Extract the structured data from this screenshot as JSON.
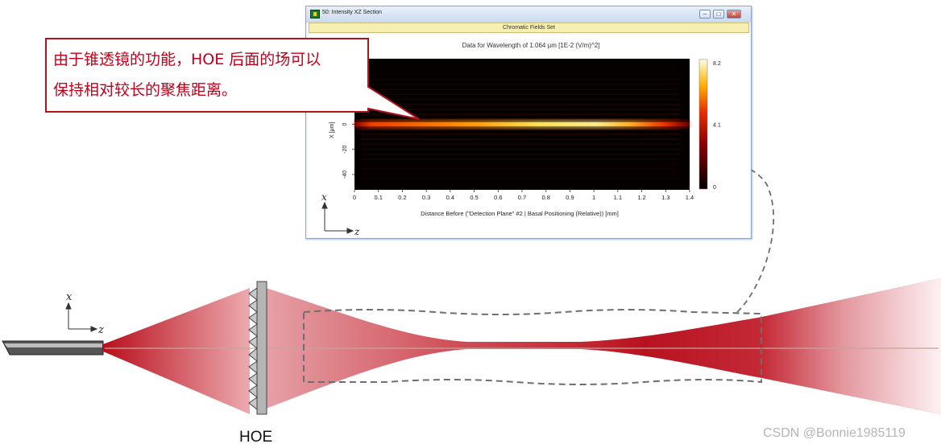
{
  "window": {
    "title": "50: Intensity XZ Section",
    "buttons": {
      "minimize": "–",
      "maximize": "□",
      "close": "✕"
    },
    "banner": "Chromatic Fields Set",
    "plot_title": "Data for Wavelength of 1.064 µm  [1E-2 (V/m)^2]"
  },
  "callout": {
    "line1": "由于锥透镜的功能，HOE 后面的场可以",
    "line2": "保持相对较长的聚焦距离。",
    "color": "#c0001a"
  },
  "labels": {
    "hoe": "HOE",
    "inset_axis_x": "x",
    "inset_axis_z": "z",
    "scene_axis_x": "x",
    "scene_axis_z": "z"
  },
  "watermark": "CSDN @Bonnie1985119",
  "colors": {
    "beam": "#c0121f",
    "frame": "#b01020",
    "dash": "#777777"
  },
  "chart_data": {
    "type": "heatmap",
    "title": "Data for Wavelength of 1.064 µm  [1E-2 (V/m)^2]",
    "xlabel": "Distance Before (\"Detection Plane\" #2 | Basal Positioning (Relative)) [mm]",
    "ylabel": "X [µm]",
    "x_ticks": [
      "0",
      "0.1",
      "0.2",
      "0.3",
      "0.4",
      "0.5",
      "0.6",
      "0.7",
      "0.8",
      "0.9",
      "1",
      "1.1",
      "1.2",
      "1.3",
      "1.4"
    ],
    "y_ticks": [
      "0",
      "-20",
      "-40"
    ],
    "xlim": [
      0,
      1.4
    ],
    "colorbar": {
      "ticks": [
        "8.2",
        "4.1",
        "0"
      ],
      "range": [
        0,
        8.2
      ]
    },
    "beam_intensity_profile": {
      "z": [
        0,
        0.05,
        0.1,
        0.2,
        0.3,
        0.4,
        0.5,
        0.6,
        0.7,
        0.8,
        0.9,
        1.0,
        1.1,
        1.2,
        1.3,
        1.35,
        1.4
      ],
      "peak": [
        0.9,
        2.6,
        3.6,
        4.5,
        5.0,
        5.4,
        6.0,
        6.7,
        7.3,
        7.5,
        7.6,
        8.2,
        7.4,
        5.6,
        3.6,
        2.4,
        1.4
      ]
    }
  }
}
